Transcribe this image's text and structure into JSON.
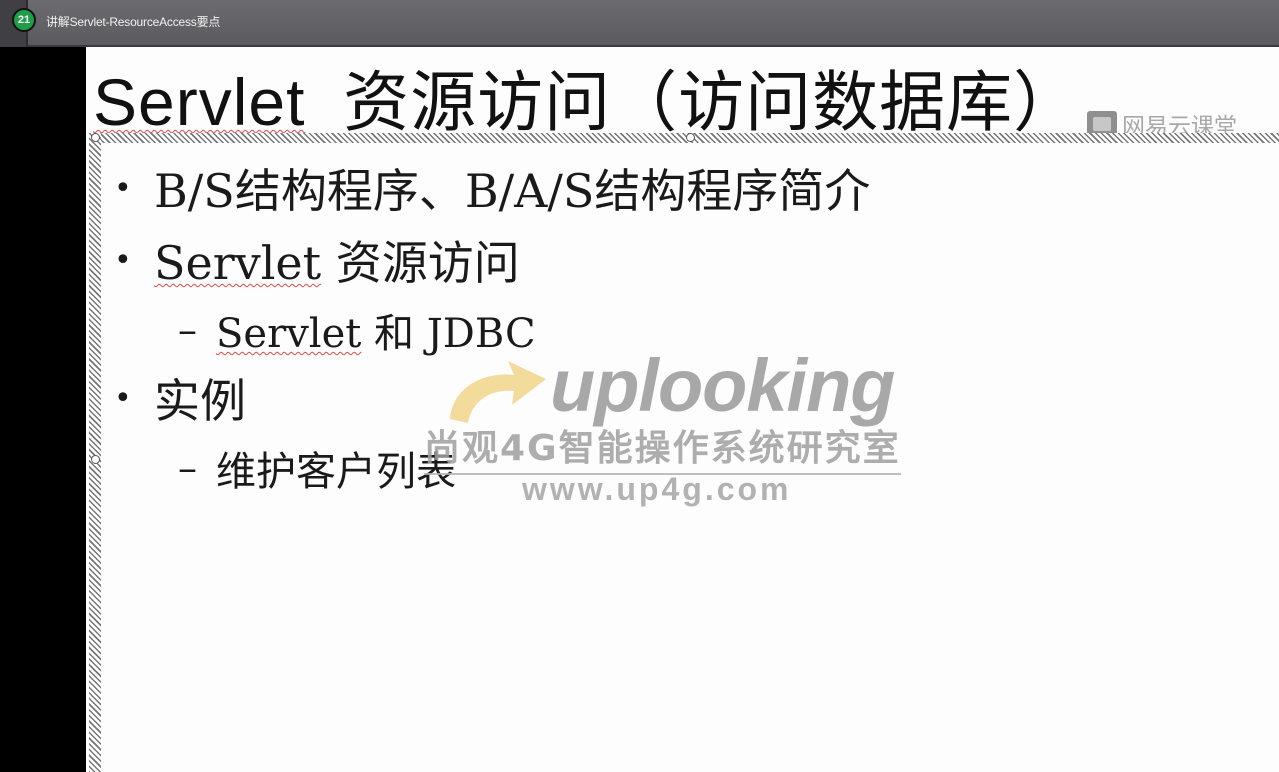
{
  "header": {
    "lesson_number": "21",
    "title": "讲解Servlet-ResourceAccess要点"
  },
  "slide": {
    "title_prefix": "Servlet",
    "title_rest": "_资源访问（访问数据库）",
    "bullets": [
      {
        "level": 1,
        "text": "B/S结构程序、B/A/S结构程序简介"
      },
      {
        "level": 1,
        "word": "Servlet",
        "rest": " 资源访问"
      },
      {
        "level": 2,
        "word": "Servlet",
        "rest": " 和 JDBC"
      },
      {
        "level": 1,
        "text": "实例"
      },
      {
        "level": 2,
        "text": "维护客户列表"
      }
    ],
    "bullet_glyph": "•",
    "dash_glyph": "–"
  },
  "watermarks": {
    "corner": "网易云课堂",
    "brand": "uplooking",
    "brand_sub": "尚观4G智能操作系统研究室",
    "brand_url": "www.up4g.com",
    "arrow_color": "#f0d58a"
  },
  "colors": {
    "slide_bg": "#fdfdfd",
    "badge": "#1f9e4a",
    "spellcheck": "#e04848"
  }
}
